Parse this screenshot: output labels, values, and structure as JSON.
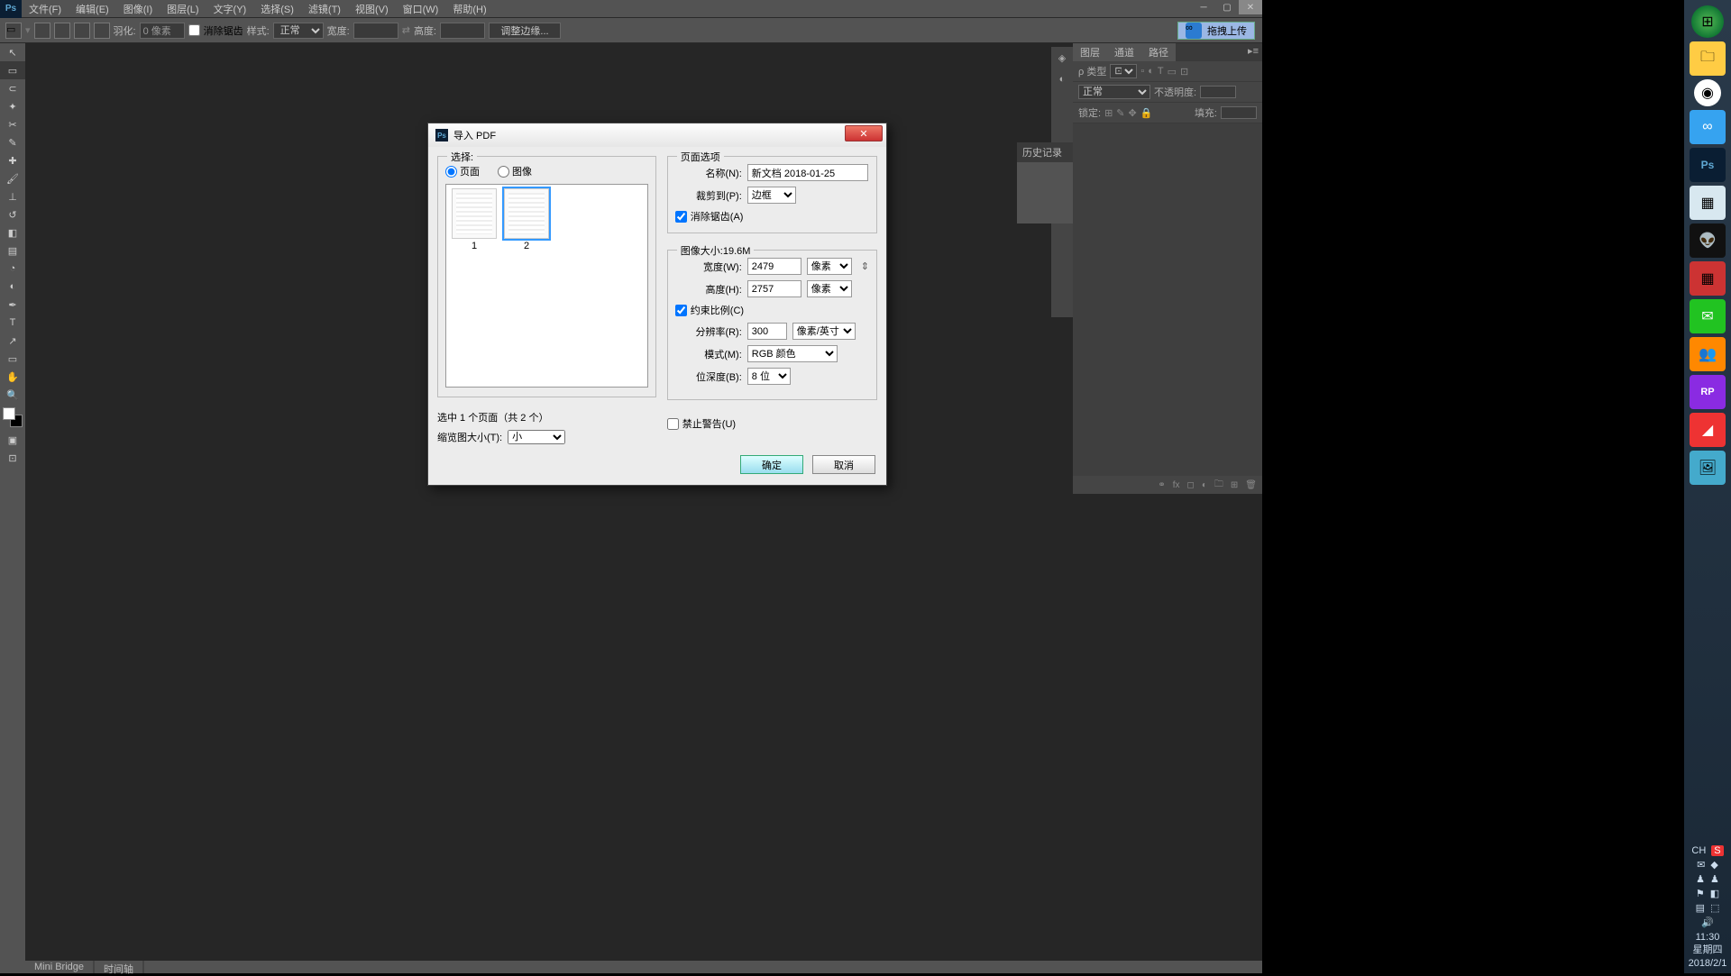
{
  "menu": {
    "items": [
      "文件(F)",
      "编辑(E)",
      "图像(I)",
      "图层(L)",
      "文字(Y)",
      "选择(S)",
      "滤镜(T)",
      "视图(V)",
      "窗口(W)",
      "帮助(H)"
    ]
  },
  "optbar": {
    "feather_label": "羽化:",
    "feather_val": "0 像素",
    "antialias": "消除锯齿",
    "style_label": "样式:",
    "style_val": "正常",
    "width_label": "宽度:",
    "height_label": "高度:",
    "adjust": "调整边缘..."
  },
  "upload_btn": "拖拽上传",
  "panels": {
    "tabs": [
      "图层",
      "通道",
      "路径"
    ],
    "kind_label": "ρ 类型",
    "blend": "正常",
    "opacity_label": "不透明度:",
    "lock_label": "锁定:",
    "fill_label": "填充:",
    "history": "历史记录"
  },
  "status": {
    "tabs": [
      "Mini Bridge",
      "时间轴"
    ]
  },
  "dialog": {
    "title": "导入 PDF",
    "select_legend": "选择:",
    "radio_page": "页面",
    "radio_image": "图像",
    "thumbs": [
      {
        "num": "1"
      },
      {
        "num": "2"
      }
    ],
    "sel_status": "选中 1 个页面（共 2 个）",
    "thumbsize_label": "缩览图大小(T):",
    "thumbsize_val": "小",
    "po_legend": "页面选项",
    "name_label": "名称(N):",
    "name_val": "新文档 2018-01-25",
    "crop_label": "裁剪到(P):",
    "crop_val": "边框",
    "antialias_label": "消除锯齿(A)",
    "size_legend": "图像大小:19.6M",
    "width_label": "宽度(W):",
    "width_val": "2479",
    "width_unit": "像素",
    "height_label": "高度(H):",
    "height_val": "2757",
    "height_unit": "像素",
    "constrain": "约束比例(C)",
    "res_label": "分辨率(R):",
    "res_val": "300",
    "res_unit": "像素/英寸",
    "mode_label": "模式(M):",
    "mode_val": "RGB 颜色",
    "depth_label": "位深度(B):",
    "depth_val": "8 位",
    "suppress": "禁止警告(U)",
    "ok": "确定",
    "cancel": "取消"
  },
  "taskbar": {
    "ime": "CH",
    "time": "11:30",
    "day": "星期四",
    "date": "2018/2/1"
  }
}
